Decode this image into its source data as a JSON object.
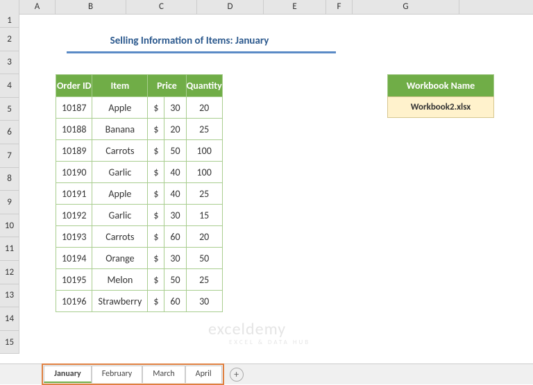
{
  "columns": [
    "A",
    "B",
    "C",
    "D",
    "E",
    "F",
    "G"
  ],
  "rows": [
    "1",
    "2",
    "3",
    "4",
    "5",
    "6",
    "7",
    "8",
    "9",
    "10",
    "11",
    "12",
    "13",
    "14",
    "15"
  ],
  "title": "Selling Information of Items: January",
  "table": {
    "headers": {
      "order_id": "Order ID",
      "item": "Item",
      "price": "Price",
      "quantity": "Quantity"
    },
    "rows": [
      {
        "order_id": "10187",
        "item": "Apple",
        "price_sym": "$",
        "price": "30",
        "quantity": "20"
      },
      {
        "order_id": "10188",
        "item": "Banana",
        "price_sym": "$",
        "price": "20",
        "quantity": "25"
      },
      {
        "order_id": "10189",
        "item": "Carrots",
        "price_sym": "$",
        "price": "50",
        "quantity": "100"
      },
      {
        "order_id": "10190",
        "item": "Garlic",
        "price_sym": "$",
        "price": "40",
        "quantity": "100"
      },
      {
        "order_id": "10191",
        "item": "Apple",
        "price_sym": "$",
        "price": "40",
        "quantity": "25"
      },
      {
        "order_id": "10192",
        "item": "Garlic",
        "price_sym": "$",
        "price": "30",
        "quantity": "15"
      },
      {
        "order_id": "10193",
        "item": "Carrots",
        "price_sym": "$",
        "price": "60",
        "quantity": "20"
      },
      {
        "order_id": "10194",
        "item": "Orange",
        "price_sym": "$",
        "price": "30",
        "quantity": "50"
      },
      {
        "order_id": "10195",
        "item": "Melon",
        "price_sym": "$",
        "price": "50",
        "quantity": "25"
      },
      {
        "order_id": "10196",
        "item": "Strawberry",
        "price_sym": "$",
        "price": "60",
        "quantity": "30"
      }
    ]
  },
  "workbook_info": {
    "header": "Workbook Name",
    "value": "Workbook2.xlsx"
  },
  "sheet_tabs": [
    "January",
    "February",
    "March",
    "April"
  ],
  "active_tab": "January",
  "new_sheet_icon": "+",
  "watermark": {
    "main": "exceldemy",
    "sub": "EXCEL & DATA HUB"
  }
}
